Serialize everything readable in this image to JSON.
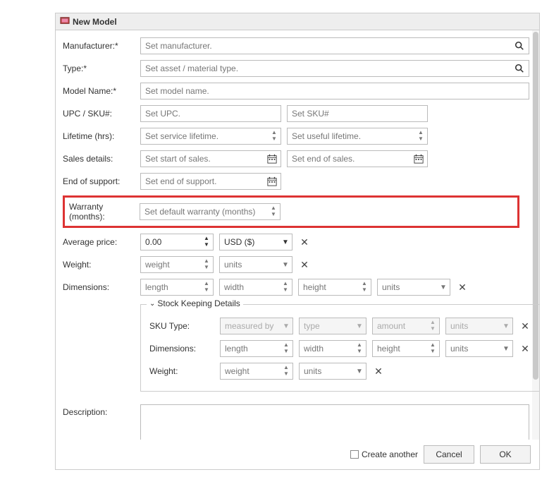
{
  "title": "New Model",
  "labels": {
    "manufacturer": "Manufacturer:",
    "type": "Type:",
    "modelName": "Model Name:",
    "upcSku": "UPC / SKU#:",
    "lifetime": "Lifetime (hrs):",
    "salesDetails": "Sales details:",
    "endOfSupport": "End of support:",
    "warranty": "Warranty (months):",
    "avgPrice": "Average price:",
    "weight": "Weight:",
    "dimensions": "Dimensions:",
    "description": "Description:"
  },
  "placeholders": {
    "manufacturer": "Set manufacturer.",
    "type": "Set asset / material type.",
    "modelName": "Set model name.",
    "upc": "Set UPC.",
    "sku": "Set SKU#",
    "serviceLifetime": "Set service lifetime.",
    "usefulLifetime": "Set useful lifetime.",
    "startSales": "Set start of sales.",
    "endSales": "Set end of sales.",
    "endOfSupport": "Set end of support.",
    "warranty": "Set default warranty (months)",
    "weight": "weight",
    "units": "units",
    "length": "length",
    "width": "width",
    "height": "height"
  },
  "values": {
    "avgPrice": "0.00",
    "currency": "USD ($)"
  },
  "stock": {
    "legend": "Stock Keeping Details",
    "labels": {
      "skuType": "SKU Type:",
      "dimensions": "Dimensions:",
      "weight": "Weight:"
    },
    "placeholders": {
      "measuredBy": "measured by",
      "type": "type",
      "amount": "amount",
      "units": "units",
      "length": "length",
      "width": "width",
      "height": "height",
      "weight": "weight"
    }
  },
  "footer": {
    "createAnother": "Create another",
    "cancel": "Cancel",
    "ok": "OK"
  }
}
